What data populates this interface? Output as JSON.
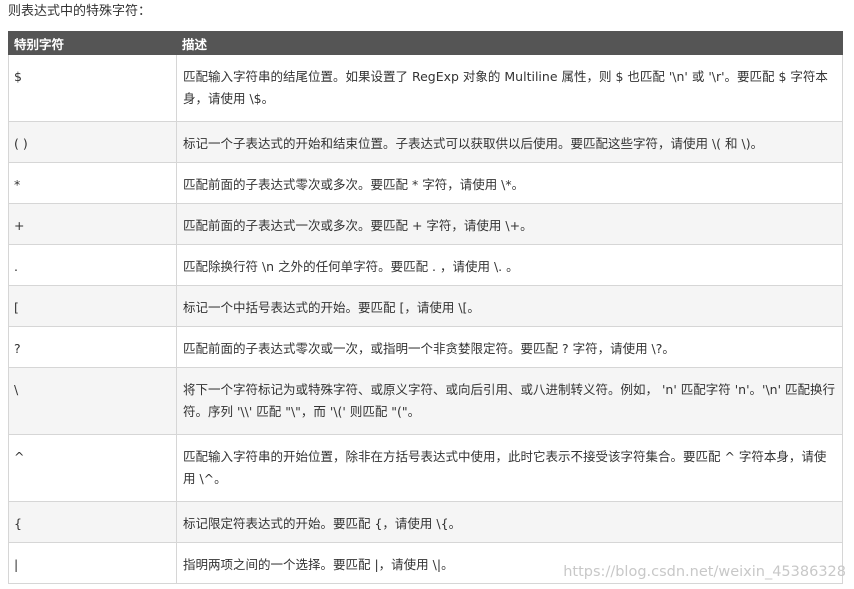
{
  "intro_text": "则表达式中的特殊字符：",
  "table": {
    "headers": [
      "特别字符",
      "描述"
    ],
    "rows": [
      {
        "char": "$",
        "desc": "匹配输入字符串的结尾位置。如果设置了 RegExp 对象的 Multiline 属性，则 $ 也匹配 '\\n' 或 '\\r'。要匹配 $ 字符本身，请使用 \\$。"
      },
      {
        "char": "( )",
        "desc": "标记一个子表达式的开始和结束位置。子表达式可以获取供以后使用。要匹配这些字符，请使用 \\( 和 \\)。"
      },
      {
        "char": "*",
        "desc": "匹配前面的子表达式零次或多次。要匹配 * 字符，请使用 \\*。"
      },
      {
        "char": "+",
        "desc": "匹配前面的子表达式一次或多次。要匹配 + 字符，请使用 \\+。"
      },
      {
        "char": ".",
        "desc": "匹配除换行符 \\n 之外的任何单字符。要匹配 . ，请使用 \\. 。"
      },
      {
        "char": "[",
        "desc": "标记一个中括号表达式的开始。要匹配 [，请使用 \\[。"
      },
      {
        "char": "?",
        "desc": "匹配前面的子表达式零次或一次，或指明一个非贪婪限定符。要匹配 ? 字符，请使用 \\?。"
      },
      {
        "char": "\\",
        "desc": "将下一个字符标记为或特殊字符、或原义字符、或向后引用、或八进制转义符。例如， 'n' 匹配字符 'n'。'\\n' 匹配换行符。序列 '\\\\' 匹配 \"\\\"，而 '\\(' 则匹配 \"(\"。"
      },
      {
        "char": "^",
        "desc": "匹配输入字符串的开始位置，除非在方括号表达式中使用，此时它表示不接受该字符集合。要匹配 ^ 字符本身，请使用 \\^。"
      },
      {
        "char": "{",
        "desc": "标记限定符表达式的开始。要匹配 {，请使用 \\{。"
      },
      {
        "char": "|",
        "desc": "指明两项之间的一个选择。要匹配 |，请使用 \\|。"
      }
    ]
  },
  "watermark": "https://blog.csdn.net/weixin_45386328"
}
